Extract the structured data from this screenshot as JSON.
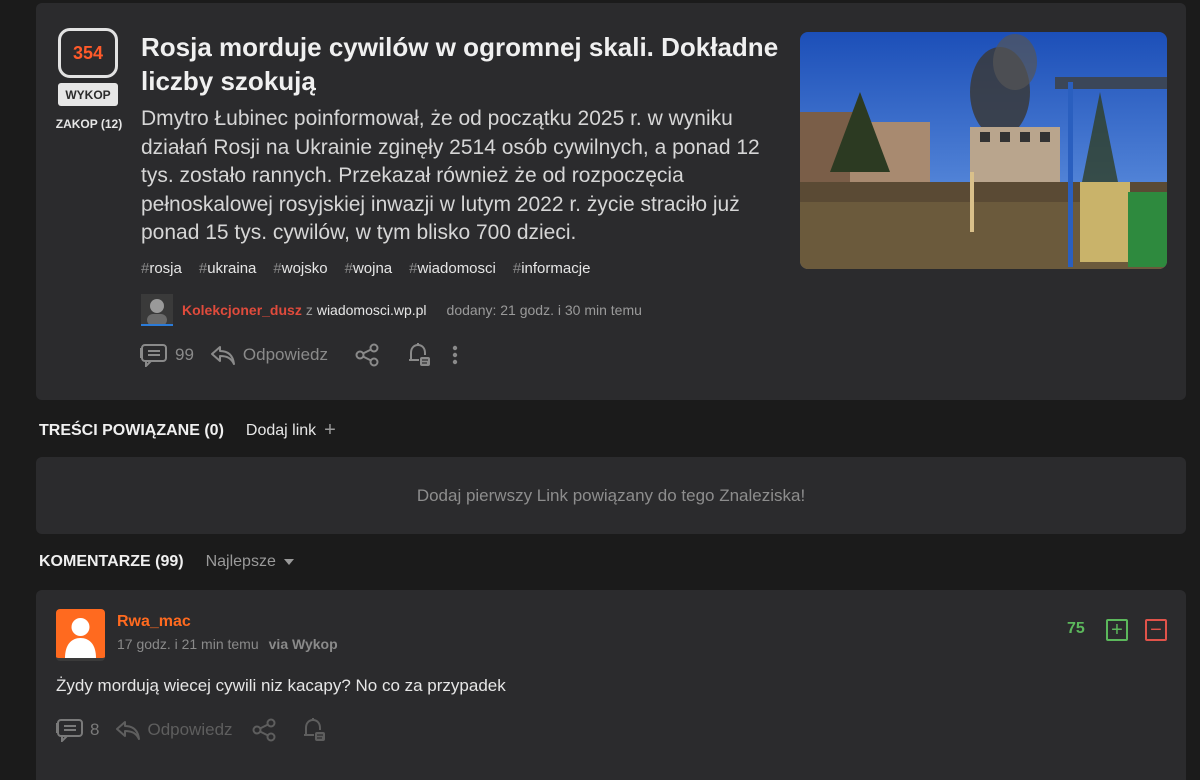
{
  "post": {
    "votes": "354",
    "wykop_label": "WYKOP",
    "zakop_label": "ZAKOP (12)",
    "title": "Rosja morduje cywilów w ogromnej skali. Dokładne liczby szokują",
    "description": "Dmytro Łubinec poinformował, że od początku 2025 r. w wyniku działań Rosji na Ukrainie zginęły 2514 osób cywilnych, a ponad 12 tys. zostało rannych. Przekazał również że od rozpoczęcia pełnoskalowej rosyjskiej inwazji w lutym 2022 r. życie straciło już ponad 15 tys. cywilów, w tym blisko 700 dzieci.",
    "tags": [
      {
        "hash": "#",
        "name": "rosja"
      },
      {
        "hash": "#",
        "name": "ukraina"
      },
      {
        "hash": "#",
        "name": "wojsko"
      },
      {
        "hash": "#",
        "name": "wojna"
      },
      {
        "hash": "#",
        "name": "wiadomosci"
      },
      {
        "hash": "#",
        "name": "informacje"
      }
    ],
    "author": "Kolekcjoner_dusz",
    "author_from": "z",
    "source": "wiadomosci.wp.pl",
    "added": "dodany: 21 godz. i 30 min temu",
    "comments_count": "99",
    "reply_label": "Odpowiedz"
  },
  "related": {
    "heading": "TREŚCI POWIĄZANE (0)",
    "add_link": "Dodaj link",
    "plus": "+",
    "empty_text": "Dodaj pierwszy Link powiązany do tego Znaleziska!"
  },
  "comments": {
    "heading": "KOMENTARZE (99)",
    "sort": "Najlepsze"
  },
  "comment": {
    "user": "Rwa_mac",
    "time": "17 godz. i 21 min temu",
    "via": "via Wykop",
    "score": "75",
    "plus": "+",
    "minus": "−",
    "text": "Żydy mordują wiecej cywili niz kacapy? No co za przypadek",
    "replies": "8",
    "reply_label": "Odpowiedz"
  },
  "colors": {
    "accent": "#ff5a2a",
    "author_red": "#e04b3c",
    "upvote_green": "#5cb85c",
    "downvote_red": "#e0534a",
    "card_bg": "#2b2b2d",
    "page_bg": "#1b1b1b"
  },
  "icons": [
    "comments-icon",
    "reply-icon",
    "share-icon",
    "notify-icon",
    "more-icon",
    "user-avatar-icon"
  ]
}
